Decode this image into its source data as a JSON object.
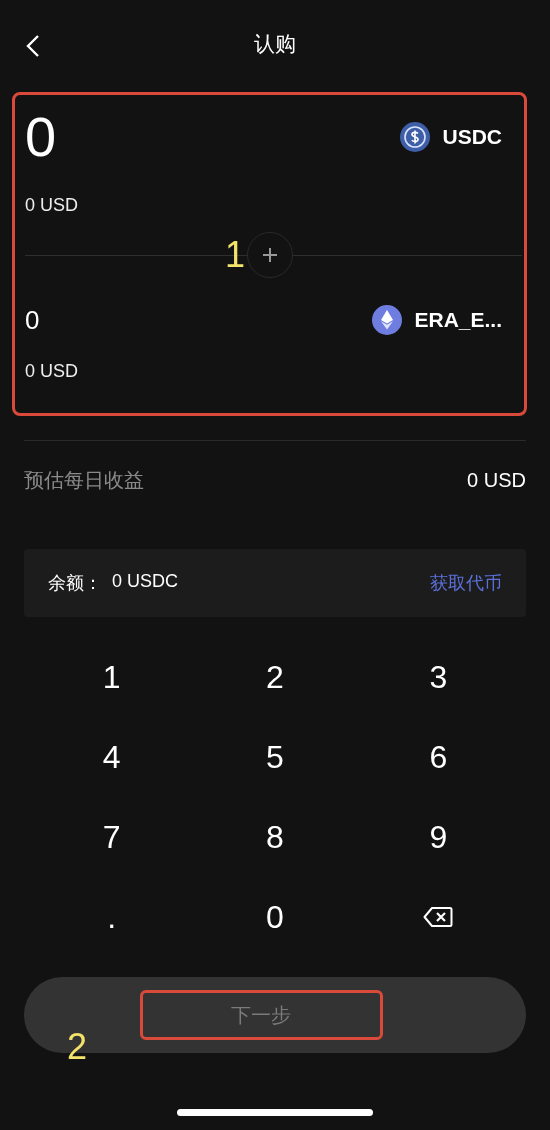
{
  "header": {
    "title": "认购"
  },
  "pair": {
    "tokens": [
      {
        "amount": "0",
        "value": "0 USD",
        "symbol": "USDC",
        "kind": "usdc",
        "active": true
      },
      {
        "amount": "0",
        "value": "0 USD",
        "symbol": "ERA_E...",
        "kind": "eth",
        "active": false
      }
    ]
  },
  "estimate": {
    "label": "预估每日收益",
    "value": "0 USD"
  },
  "balance": {
    "label": "余额：",
    "value": "0 USDC",
    "link": "获取代币"
  },
  "keypad": [
    {
      "label": "1",
      "kind": "digit"
    },
    {
      "label": "2",
      "kind": "digit"
    },
    {
      "label": "3",
      "kind": "digit"
    },
    {
      "label": "4",
      "kind": "digit"
    },
    {
      "label": "5",
      "kind": "digit"
    },
    {
      "label": "6",
      "kind": "digit"
    },
    {
      "label": "7",
      "kind": "digit"
    },
    {
      "label": "8",
      "kind": "digit"
    },
    {
      "label": "9",
      "kind": "digit"
    },
    {
      "label": ".",
      "kind": "digit"
    },
    {
      "label": "0",
      "kind": "digit"
    },
    {
      "kind": "backspace"
    }
  ],
  "next_button": {
    "label": "下一步",
    "disabled": true
  },
  "annotations": [
    {
      "label": "1"
    },
    {
      "label": "2"
    }
  ]
}
